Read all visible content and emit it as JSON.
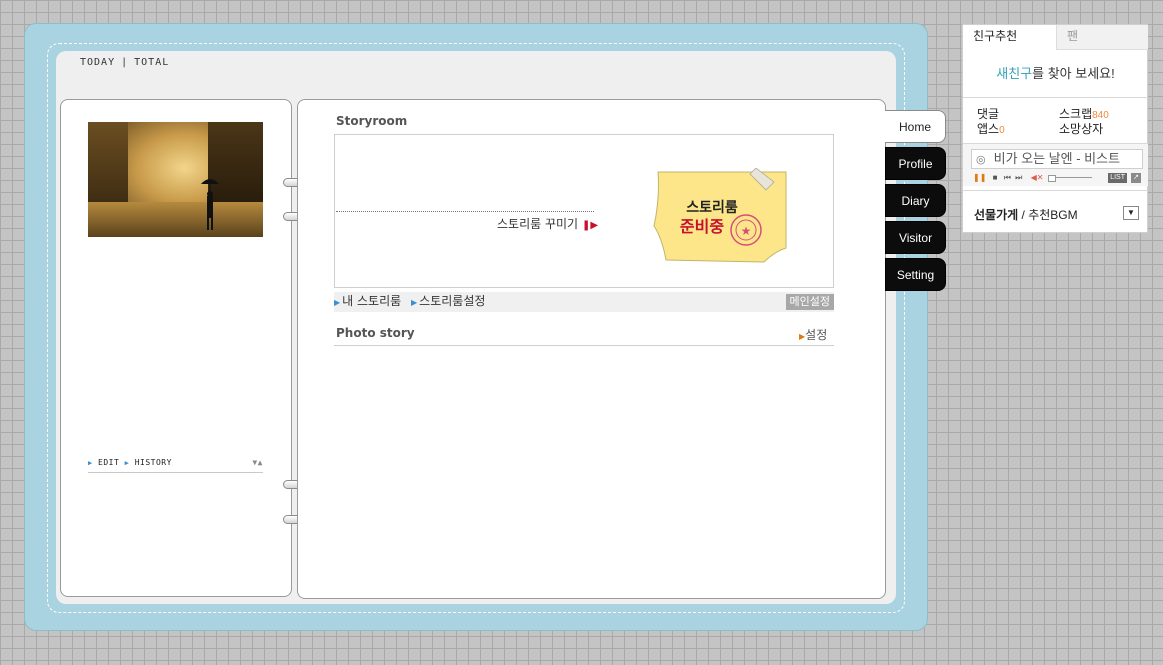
{
  "counter": {
    "today_label": "TODAY",
    "sep": "|",
    "total_label": "TOTAL"
  },
  "left": {
    "edit": "EDIT",
    "history": "HISTORY",
    "arrows": "▼▲"
  },
  "storyroom": {
    "title": "Storyroom",
    "decorate": "스토리룸 꾸미기",
    "note_line1": "스토리룸",
    "note_line2": "준비중",
    "my_storyroom": "내 스토리룸",
    "settings": "스토리룸설정",
    "main_setting": "메인설정"
  },
  "photo_story": {
    "title": "Photo story",
    "setting": "설정"
  },
  "tabs": [
    {
      "label": "Home"
    },
    {
      "label": "Profile"
    },
    {
      "label": "Diary"
    },
    {
      "label": "Visitor"
    },
    {
      "label": "Setting"
    }
  ],
  "widget": {
    "tab_recommend": "친구추천",
    "tab_fan": "팬",
    "find_highlight": "새친구",
    "find_rest": "를 찾아 보세요!",
    "comments_label": "댓글",
    "scrap_label": "스크랩",
    "scrap_count": "840",
    "apps_label": "앱스",
    "apps_count": "0",
    "wishbox_label": "소망상자",
    "song_title": "비가 오는 날엔 - 비스트",
    "list_btn": "LIST",
    "gift_shop": "선물가게",
    "gift_sep": " / ",
    "recommend_bgm": "추천BGM"
  },
  "colors": {
    "frame": "#a9d3e0",
    "tab_dark": "#0c0c0c",
    "highlight": "#36a0b8",
    "count": "#f08a3c",
    "accent_red": "#c8102e"
  }
}
